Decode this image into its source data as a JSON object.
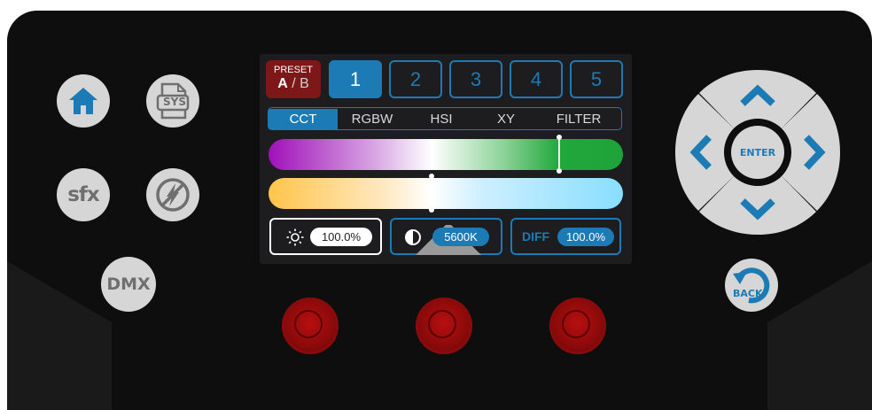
{
  "buttons": {
    "sfx_label": "sfx",
    "sys_label": "SYS",
    "dmx_label": "DMX",
    "enter_label": "ENTER",
    "back_label": "BACK"
  },
  "screen": {
    "preset": {
      "label": "PRESET",
      "a": "A",
      "separator": "/",
      "b": "B"
    },
    "preset_numbers": [
      "1",
      "2",
      "3",
      "4",
      "5"
    ],
    "active_preset": "1",
    "tabs": [
      "CCT",
      "RGBW",
      "HSI",
      "XY",
      "FILTER"
    ],
    "active_tab": "CCT",
    "green_magenta_level": 0.82,
    "cct_level": 0.46,
    "brightness_value": "100.0%",
    "cct_value": "5600K",
    "diff_label": "DIFF",
    "diff_value": "100.0%"
  },
  "colors": {
    "accent": "#1c7bb5",
    "preset_red": "#7d1718",
    "button_gray": "#d6d6d6",
    "knob_red": "#b80f10"
  },
  "icons": [
    "home-icon",
    "sys-file-icon",
    "sfx-icon",
    "flash-off-icon",
    "dmx-icon",
    "up-arrow-icon",
    "down-arrow-icon",
    "left-arrow-icon",
    "right-arrow-icon",
    "back-arrow-icon",
    "sun-icon",
    "contrast-icon"
  ]
}
